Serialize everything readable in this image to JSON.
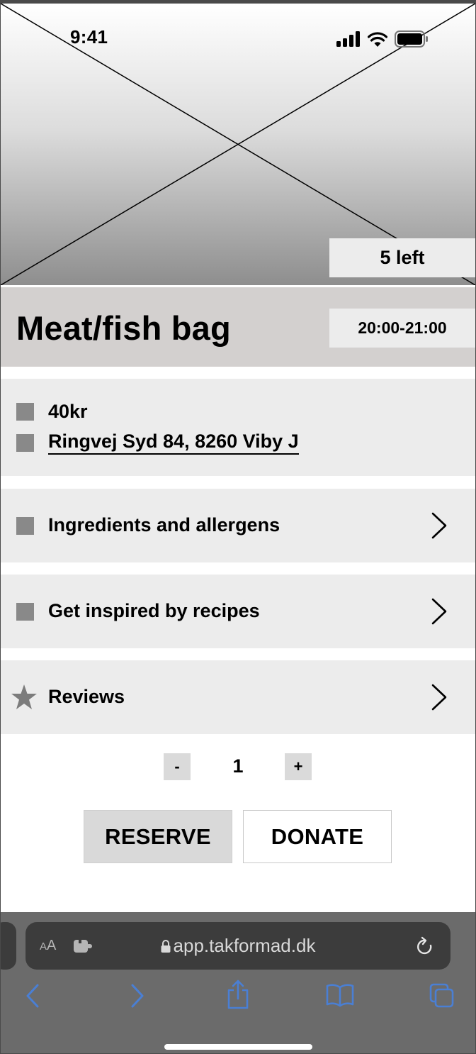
{
  "status_bar": {
    "time": "9:41",
    "icons": [
      "cellular-signal-icon",
      "wifi-icon",
      "battery-icon"
    ]
  },
  "hero": {
    "image": "image-placeholder",
    "stock_badge": "5 left"
  },
  "product": {
    "title": "Meat/fish bag",
    "pickup_time": "20:00-21:00"
  },
  "info": {
    "price": "40kr",
    "address": "Ringvej Syd 84, 8260 Viby J"
  },
  "sections": [
    {
      "label": "Ingredients and allergens",
      "icon": "square-icon"
    },
    {
      "label": "Get inspired by recipes",
      "icon": "square-icon"
    },
    {
      "label": "Reviews",
      "icon": "star-icon"
    }
  ],
  "quantity": {
    "minus_label": "-",
    "value": "1",
    "plus_label": "+"
  },
  "actions": {
    "reserve_label": "RESERVE",
    "donate_label": "DONATE"
  },
  "browser": {
    "text_size_label_small": "A",
    "text_size_label_large": "A",
    "url": "app.takformad.dk",
    "toolbar_icons": [
      "back-icon",
      "forward-icon",
      "share-icon",
      "bookmarks-icon",
      "tabs-icon"
    ]
  },
  "colors": {
    "title_bar": "#d3d0cf",
    "card": "#ececec",
    "placeholder_square": "#898989",
    "browser_accent": "#4a7fd4"
  }
}
